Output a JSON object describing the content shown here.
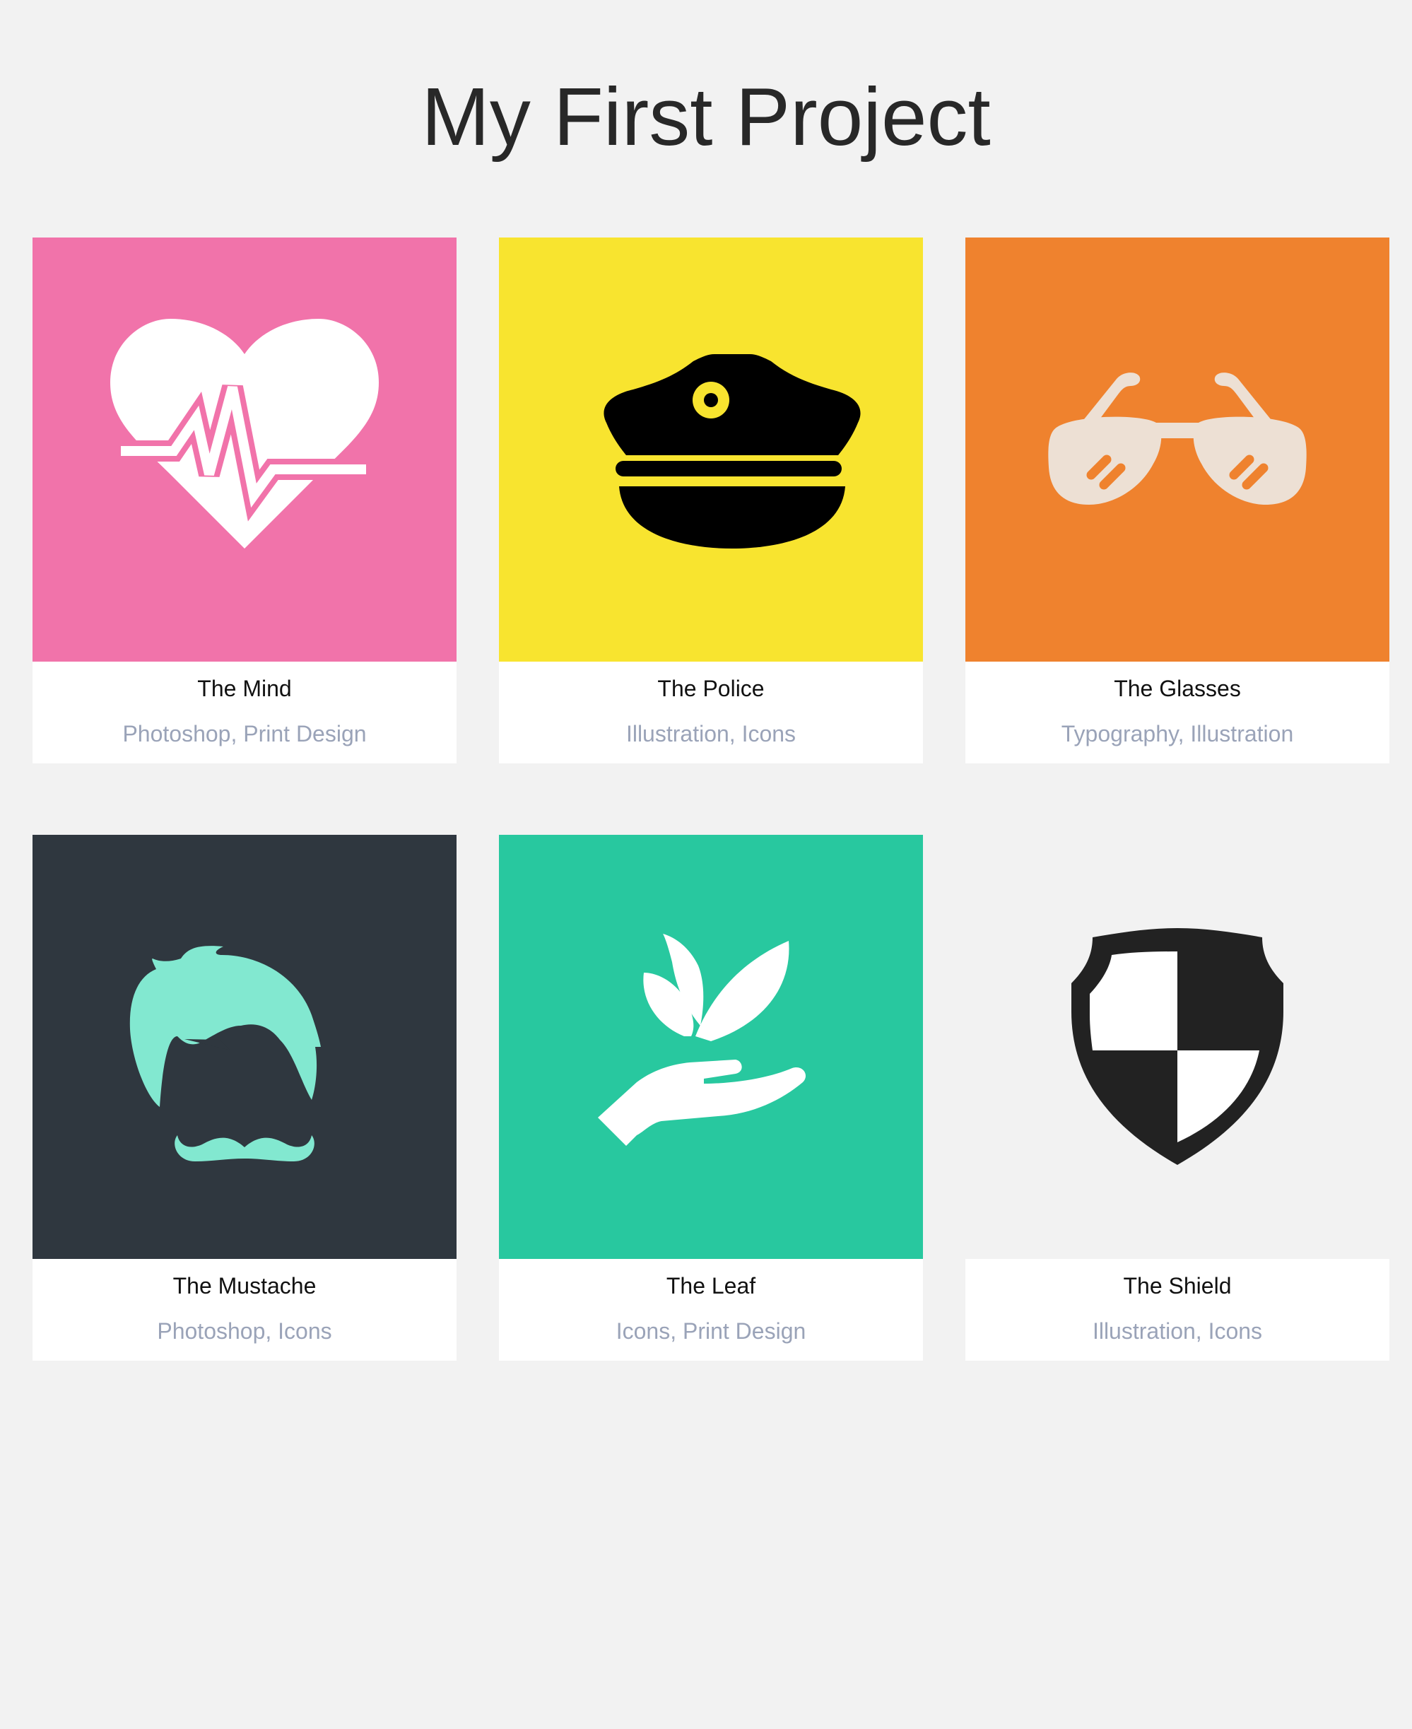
{
  "page": {
    "title": "My First Project"
  },
  "colors": {
    "background": "#f2f2f2",
    "title_text": "#282828",
    "card_title": "#111111",
    "card_tags": "#9aa3b8"
  },
  "cards": [
    {
      "title": "The Mind",
      "tags": "Photoshop, Print Design",
      "bg": "#f173aa",
      "icon": "heartbeat-icon"
    },
    {
      "title": "The Police",
      "tags": "Illustration, Icons",
      "bg": "#f8e42f",
      "icon": "police-cap-icon"
    },
    {
      "title": "The Glasses",
      "tags": "Typography, Illustration",
      "bg": "#ef822e",
      "icon": "sunglasses-icon"
    },
    {
      "title": "The Mustache",
      "tags": "Photoshop, Icons",
      "bg": "#2f373f",
      "icon": "mustache-icon"
    },
    {
      "title": "The Leaf",
      "tags": "Icons, Print Design",
      "bg": "#28c89f",
      "icon": "leaf-hand-icon"
    },
    {
      "title": "The Shield",
      "tags": "Illustration, Icons",
      "bg": "#f2f2f2",
      "icon": "shield-icon"
    }
  ]
}
